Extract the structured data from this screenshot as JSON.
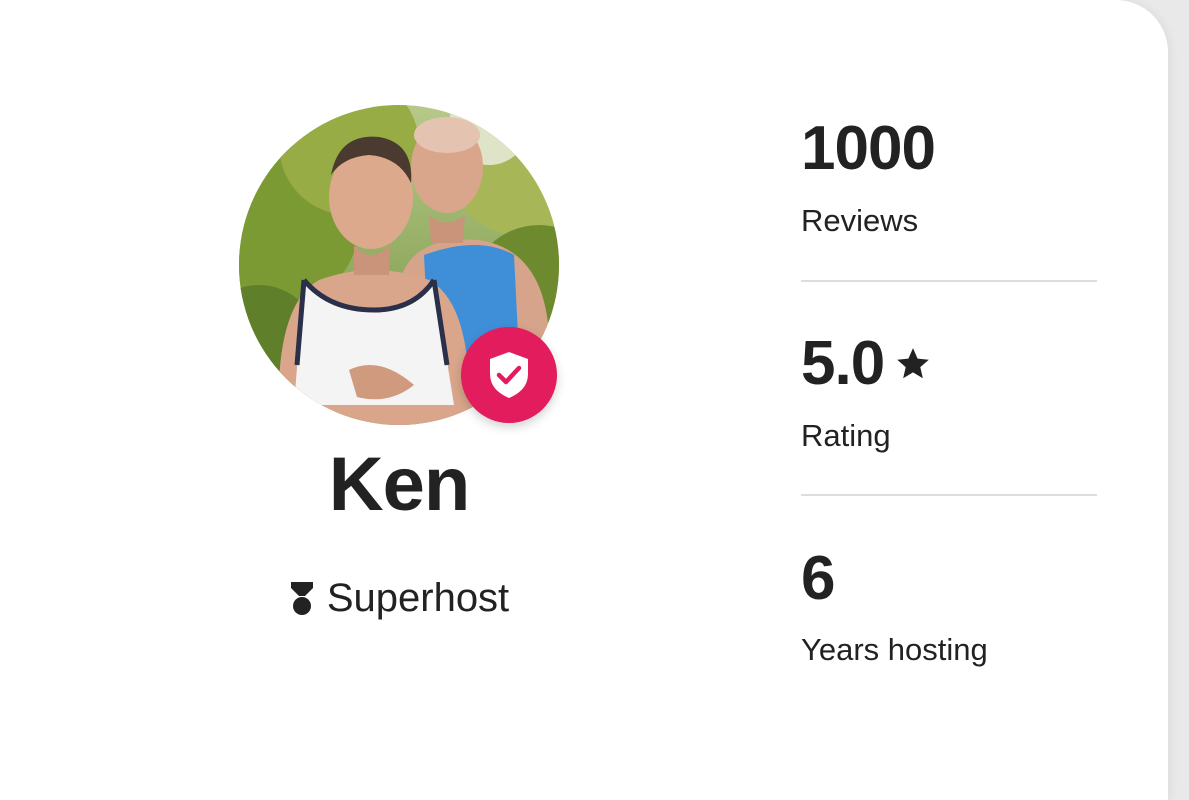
{
  "host": {
    "name": "Ken",
    "badge": "Superhost",
    "badge_icon": "superhost-medal-icon",
    "verified_icon": "verified-shield-check-icon",
    "accent_color": "#e21c5d"
  },
  "stats": [
    {
      "value": "1000",
      "label": "Reviews"
    },
    {
      "value": "5.0",
      "label": "Rating",
      "icon": "star-icon"
    },
    {
      "value": "6",
      "label": "Years hosting"
    }
  ]
}
